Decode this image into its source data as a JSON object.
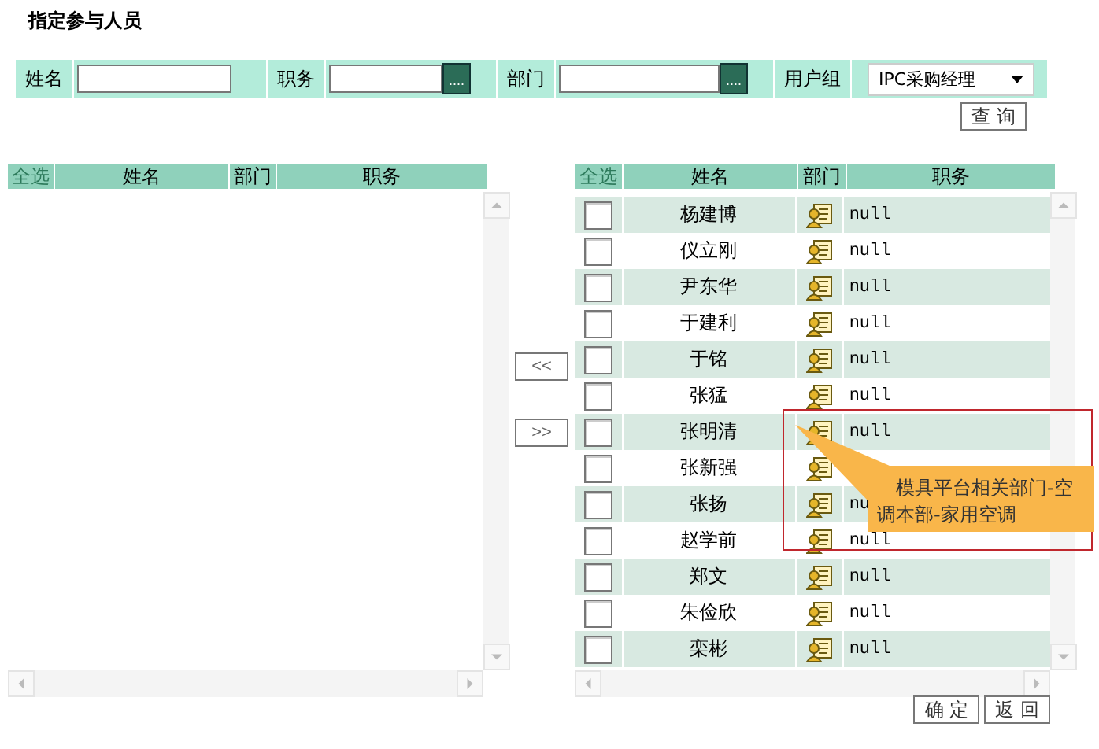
{
  "title": "指定参与人员",
  "filters": [
    {
      "label": "姓名"
    },
    {
      "label": "职务",
      "picker": "...."
    },
    {
      "label": "部门",
      "picker": "...."
    }
  ],
  "user_group": {
    "label": "用户组",
    "value": "IPC采购经理"
  },
  "search_button": "查 询",
  "left_table": {
    "columns": [
      "全选",
      "姓名",
      "部门",
      "职务"
    ]
  },
  "move_buttons": [
    "<<",
    ">>"
  ],
  "right_table": {
    "columns": [
      "全选",
      "姓名",
      "部门",
      "职务"
    ],
    "rows": [
      {
        "name": "杨建博",
        "checked": false,
        "job": "null"
      },
      {
        "name": "仪立刚",
        "checked": false,
        "job": "null"
      },
      {
        "name": "尹东华",
        "checked": false,
        "job": "null"
      },
      {
        "name": "于建利",
        "checked": false,
        "job": "null"
      },
      {
        "name": "于铭",
        "checked": false,
        "job": "null"
      },
      {
        "name": "张猛",
        "checked": false,
        "job": "null"
      },
      {
        "name": "张明清",
        "checked": false,
        "job": "null"
      },
      {
        "name": "张新强",
        "checked": false
      },
      {
        "name": "张扬",
        "checked": false,
        "job": "nu"
      },
      {
        "name": "赵学前",
        "checked": false,
        "job": "null"
      },
      {
        "name": "郑文",
        "checked": false,
        "job": "null"
      },
      {
        "name": "朱俭欣",
        "checked": false,
        "job": "null"
      },
      {
        "name": "栾彬",
        "checked": false,
        "job": "null"
      }
    ]
  },
  "tooltip": {
    "text": "模具平台相关部门-空调本部-家用空调"
  },
  "buttons": [
    "确 定",
    "返 回"
  ]
}
